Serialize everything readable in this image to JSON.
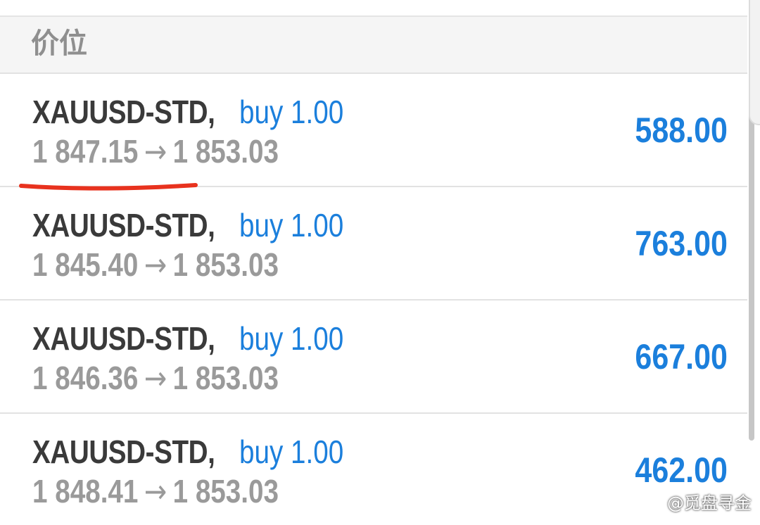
{
  "section": {
    "title": "价位"
  },
  "positions": [
    {
      "symbol": "XAUUSD-STD,",
      "order": "buy 1.00",
      "open_price": "1 847.15",
      "arrow": "→",
      "current_price": "1 853.03",
      "profit": "588.00"
    },
    {
      "symbol": "XAUUSD-STD,",
      "order": "buy 1.00",
      "open_price": "1 845.40",
      "arrow": "→",
      "current_price": "1 853.03",
      "profit": "763.00"
    },
    {
      "symbol": "XAUUSD-STD,",
      "order": "buy 1.00",
      "open_price": "1 846.36",
      "arrow": "→",
      "current_price": "1 853.03",
      "profit": "667.00"
    },
    {
      "symbol": "XAUUSD-STD,",
      "order": "buy 1.00",
      "open_price": "1 848.41",
      "arrow": "→",
      "current_price": "1 853.03",
      "profit": "462.00"
    }
  ],
  "watermark": {
    "text": "@觅盘寻金",
    "icon": "weibo-icon"
  },
  "colors": {
    "symbol_text": "#3a3a3a",
    "order_blue": "#1b7fdc",
    "price_gray": "#9a9a9a",
    "profit_blue": "#1b7fdc",
    "section_bg": "#f5f5f5",
    "annotation_red": "#e8321e"
  }
}
